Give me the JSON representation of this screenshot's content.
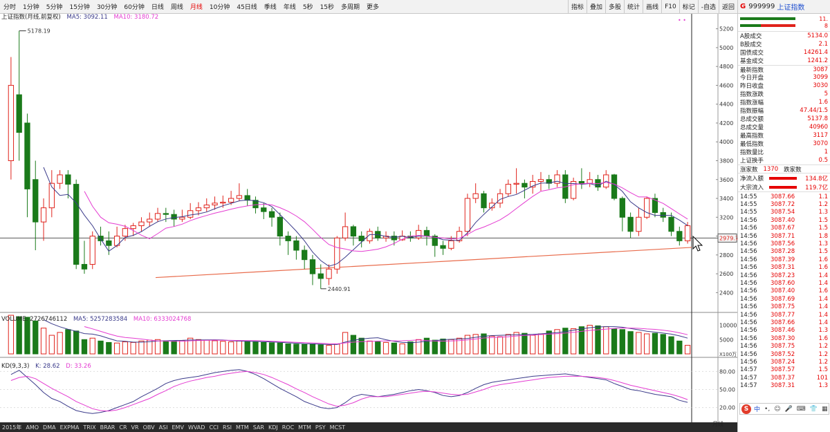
{
  "toolbar": {
    "periods": [
      "分时",
      "1分钟",
      "5分钟",
      "15分钟",
      "30分钟",
      "60分钟",
      "日线",
      "周线",
      "月线",
      "10分钟",
      "45日线",
      "季线",
      "年线",
      "5秒",
      "15秒",
      "多周期",
      "更多"
    ],
    "active_period": "月线",
    "right_tools": [
      "指标",
      "叠加",
      "多股",
      "统计",
      "画线",
      "F10",
      "标记",
      "-自选",
      "返回"
    ]
  },
  "legend": {
    "price_title": "上证指数(月线,前复权)",
    "ma5": "MA5: 3092.11",
    "ma10": "MA10: 3180.72",
    "volume": "VOLUME: 2726746112",
    "vol_ma5": "MA5: 5257283584",
    "vol_ma10": "MA10: 6333024768",
    "kd": "KD(9,3,3)",
    "kd_k": "K: 28.62",
    "kd_d": "D: 33.26"
  },
  "annotations": {
    "high": "5178.19",
    "low": "2440.91",
    "current_price": "2979.7",
    "vol_unit": "X100万"
  },
  "colors": {
    "up": "#e0221b",
    "down": "#1a7a1a",
    "ma5": "#3a3a8a",
    "ma10": "#e43bd1",
    "trend": "#e86a4a"
  },
  "chart_data": {
    "type": "candlestick",
    "price_axis": {
      "ylim": [
        2300,
        5300
      ],
      "ticks": [
        2400,
        2600,
        2800,
        3000,
        3200,
        3400,
        3600,
        3800,
        4000,
        4200,
        4400,
        4600,
        4800,
        5000,
        5200
      ]
    },
    "volume_axis": {
      "ylim": [
        0,
        14000
      ],
      "ticks": [
        5000,
        10000
      ]
    },
    "kd_axis": {
      "ylim": [
        0,
        100
      ],
      "ticks": [
        20.0,
        50.0,
        80.0
      ]
    },
    "candles": [
      {
        "o": 3800,
        "c": 4600,
        "h": 4900,
        "l": 3600
      },
      {
        "o": 4500,
        "c": 4100,
        "h": 5178.19,
        "l": 3800
      },
      {
        "o": 4200,
        "c": 3500,
        "h": 4300,
        "l": 3200
      },
      {
        "o": 3600,
        "c": 3150,
        "h": 3800,
        "l": 2850
      },
      {
        "o": 3150,
        "c": 3300,
        "h": 3400,
        "l": 2950
      },
      {
        "o": 3300,
        "c": 3560,
        "h": 3700,
        "l": 3200
      },
      {
        "o": 3560,
        "c": 3650,
        "h": 3700,
        "l": 3500
      },
      {
        "o": 3650,
        "c": 3550,
        "h": 3700,
        "l": 3400
      },
      {
        "o": 3550,
        "c": 2700,
        "h": 3600,
        "l": 2650
      },
      {
        "o": 2700,
        "c": 2650,
        "h": 2950,
        "l": 2600
      },
      {
        "o": 2700,
        "c": 3000,
        "h": 3050,
        "l": 2650
      },
      {
        "o": 3000,
        "c": 2950,
        "h": 3100,
        "l": 2900
      },
      {
        "o": 2950,
        "c": 2900,
        "h": 3050,
        "l": 2800
      },
      {
        "o": 2900,
        "c": 3000,
        "h": 3100,
        "l": 2880
      },
      {
        "o": 3000,
        "c": 3080,
        "h": 3120,
        "l": 2950
      },
      {
        "o": 3080,
        "c": 3110,
        "h": 3140,
        "l": 3000
      },
      {
        "o": 3110,
        "c": 3150,
        "h": 3200,
        "l": 3050
      },
      {
        "o": 3150,
        "c": 3180,
        "h": 3250,
        "l": 3100
      },
      {
        "o": 3180,
        "c": 3240,
        "h": 3300,
        "l": 3150
      },
      {
        "o": 3240,
        "c": 3230,
        "h": 3300,
        "l": 3150
      },
      {
        "o": 3230,
        "c": 3180,
        "h": 3280,
        "l": 3100
      },
      {
        "o": 3180,
        "c": 3200,
        "h": 3280,
        "l": 3150
      },
      {
        "o": 3200,
        "c": 3270,
        "h": 3350,
        "l": 3180
      },
      {
        "o": 3270,
        "c": 3300,
        "h": 3360,
        "l": 3220
      },
      {
        "o": 3300,
        "c": 3330,
        "h": 3400,
        "l": 3260
      },
      {
        "o": 3330,
        "c": 3350,
        "h": 3420,
        "l": 3280
      },
      {
        "o": 3350,
        "c": 3360,
        "h": 3430,
        "l": 3300
      },
      {
        "o": 3360,
        "c": 3400,
        "h": 3480,
        "l": 3330
      },
      {
        "o": 3400,
        "c": 3430,
        "h": 3560,
        "l": 3370
      },
      {
        "o": 3430,
        "c": 3380,
        "h": 3500,
        "l": 3320
      },
      {
        "o": 3380,
        "c": 3300,
        "h": 3420,
        "l": 3240
      },
      {
        "o": 3300,
        "c": 3260,
        "h": 3350,
        "l": 3180
      },
      {
        "o": 3260,
        "c": 3200,
        "h": 3300,
        "l": 3100
      },
      {
        "o": 3200,
        "c": 3000,
        "h": 3250,
        "l": 2900
      },
      {
        "o": 3000,
        "c": 2950,
        "h": 3050,
        "l": 2800
      },
      {
        "o": 2950,
        "c": 2850,
        "h": 3000,
        "l": 2750
      },
      {
        "o": 2850,
        "c": 2750,
        "h": 2900,
        "l": 2650
      },
      {
        "o": 2750,
        "c": 2600,
        "h": 2800,
        "l": 2480
      },
      {
        "o": 2600,
        "c": 2550,
        "h": 2700,
        "l": 2440.91
      },
      {
        "o": 2550,
        "c": 2650,
        "h": 2700,
        "l": 2480
      },
      {
        "o": 2650,
        "c": 2980,
        "h": 3000,
        "l": 2600
      },
      {
        "o": 2980,
        "c": 3100,
        "h": 3250,
        "l": 2950
      },
      {
        "o": 3100,
        "c": 3000,
        "h": 3120,
        "l": 2900
      },
      {
        "o": 3000,
        "c": 2950,
        "h": 3050,
        "l": 2880
      },
      {
        "o": 2950,
        "c": 3050,
        "h": 3080,
        "l": 2920
      },
      {
        "o": 3050,
        "c": 2980,
        "h": 3100,
        "l": 2950
      },
      {
        "o": 2980,
        "c": 3000,
        "h": 3050,
        "l": 2940
      },
      {
        "o": 3000,
        "c": 2960,
        "h": 3050,
        "l": 2900
      },
      {
        "o": 2960,
        "c": 3000,
        "h": 3060,
        "l": 2950
      },
      {
        "o": 3000,
        "c": 2980,
        "h": 3050,
        "l": 2940
      },
      {
        "o": 2980,
        "c": 3060,
        "h": 3120,
        "l": 2960
      },
      {
        "o": 3060,
        "c": 3000,
        "h": 3100,
        "l": 2900
      },
      {
        "o": 3000,
        "c": 2900,
        "h": 3020,
        "l": 2780
      },
      {
        "o": 2900,
        "c": 2870,
        "h": 2950,
        "l": 2800
      },
      {
        "o": 2870,
        "c": 2950,
        "h": 3000,
        "l": 2850
      },
      {
        "o": 2950,
        "c": 3050,
        "h": 3100,
        "l": 2930
      },
      {
        "o": 3050,
        "c": 3400,
        "h": 3450,
        "l": 3000
      },
      {
        "o": 3400,
        "c": 3450,
        "h": 3560,
        "l": 3350
      },
      {
        "o": 3450,
        "c": 3300,
        "h": 3480,
        "l": 3250
      },
      {
        "o": 3300,
        "c": 3350,
        "h": 3400,
        "l": 3270
      },
      {
        "o": 3350,
        "c": 3450,
        "h": 3500,
        "l": 3300
      },
      {
        "o": 3450,
        "c": 3550,
        "h": 3600,
        "l": 3420
      },
      {
        "o": 3550,
        "c": 3560,
        "h": 3720,
        "l": 3450
      },
      {
        "o": 3560,
        "c": 3520,
        "h": 3600,
        "l": 3400
      },
      {
        "o": 3520,
        "c": 3580,
        "h": 3650,
        "l": 3450
      },
      {
        "o": 3580,
        "c": 3600,
        "h": 3680,
        "l": 3480
      },
      {
        "o": 3600,
        "c": 3560,
        "h": 3650,
        "l": 3500
      },
      {
        "o": 3560,
        "c": 3650,
        "h": 3700,
        "l": 3520
      },
      {
        "o": 3650,
        "c": 3400,
        "h": 3700,
        "l": 3350
      },
      {
        "o": 3400,
        "c": 3580,
        "h": 3620,
        "l": 3380
      },
      {
        "o": 3580,
        "c": 3560,
        "h": 3720,
        "l": 3500
      },
      {
        "o": 3560,
        "c": 3600,
        "h": 3680,
        "l": 3520
      },
      {
        "o": 3600,
        "c": 3520,
        "h": 3650,
        "l": 3480
      },
      {
        "o": 3520,
        "c": 3650,
        "h": 3700,
        "l": 3500
      },
      {
        "o": 3650,
        "c": 3400,
        "h": 3660,
        "l": 3380
      },
      {
        "o": 3400,
        "c": 3200,
        "h": 3420,
        "l": 3050
      },
      {
        "o": 3200,
        "c": 3050,
        "h": 3250,
        "l": 2980
      },
      {
        "o": 3050,
        "c": 3200,
        "h": 3300,
        "l": 3000
      },
      {
        "o": 3200,
        "c": 3400,
        "h": 3420,
        "l": 3180
      },
      {
        "o": 3400,
        "c": 3250,
        "h": 3450,
        "l": 3200
      },
      {
        "o": 3250,
        "c": 3200,
        "h": 3300,
        "l": 3150
      },
      {
        "o": 3200,
        "c": 3050,
        "h": 3250,
        "l": 3000
      },
      {
        "o": 3050,
        "c": 2950,
        "h": 3100,
        "l": 2900
      },
      {
        "o": 2950,
        "c": 3110,
        "h": 3150,
        "l": 2920
      }
    ],
    "volumes": [
      13500,
      13000,
      12800,
      11500,
      9000,
      6500,
      7500,
      8500,
      8000,
      5000,
      5500,
      4500,
      4000,
      3800,
      4200,
      4000,
      4500,
      4800,
      5000,
      4600,
      4500,
      4700,
      5500,
      5000,
      4800,
      4600,
      4400,
      4200,
      4500,
      4400,
      4200,
      4000,
      3900,
      3800,
      3500,
      3400,
      3300,
      3500,
      3200,
      3000,
      3400,
      7500,
      6500,
      5500,
      4500,
      4200,
      4000,
      3800,
      3500,
      4200,
      5000,
      5500,
      4800,
      5200,
      5000,
      5500,
      6500,
      6800,
      7000,
      6200,
      6000,
      6800,
      7500,
      7200,
      6500,
      7000,
      8000,
      8500,
      9000,
      8800,
      9500,
      10000,
      9800,
      9500,
      8800,
      8500,
      7800,
      7500,
      7000,
      7200,
      6800,
      6000,
      4500,
      3000
    ],
    "kd": {
      "k": [
        75,
        82,
        70,
        58,
        45,
        35,
        30,
        22,
        15,
        12,
        10,
        12,
        15,
        20,
        25,
        30,
        38,
        45,
        52,
        60,
        65,
        68,
        70,
        72,
        75,
        78,
        80,
        82,
        83,
        80,
        75,
        68,
        60,
        52,
        45,
        38,
        30,
        25,
        20,
        18,
        20,
        28,
        38,
        42,
        40,
        38,
        40,
        42,
        45,
        48,
        50,
        48,
        45,
        40,
        38,
        40,
        45,
        52,
        58,
        62,
        64,
        66,
        68,
        70,
        72,
        73,
        74,
        75,
        76,
        74,
        72,
        70,
        68,
        66,
        60,
        55,
        50,
        48,
        45,
        42,
        40,
        38,
        32,
        28.62
      ],
      "d": [
        65,
        70,
        72,
        68,
        60,
        52,
        45,
        38,
        30,
        24,
        18,
        15,
        14,
        16,
        20,
        25,
        30,
        35,
        42,
        48,
        55,
        60,
        64,
        67,
        70,
        72,
        75,
        77,
        79,
        80,
        78,
        75,
        70,
        64,
        58,
        51,
        45,
        38,
        32,
        26,
        22,
        24,
        28,
        34,
        38,
        38,
        38,
        40,
        42,
        44,
        46,
        47,
        46,
        44,
        42,
        41,
        42,
        46,
        50,
        55,
        58,
        60,
        62,
        64,
        66,
        68,
        70,
        71,
        72,
        72,
        72,
        71,
        70,
        68,
        65,
        61,
        57,
        54,
        51,
        48,
        45,
        42,
        38,
        33.26
      ]
    }
  },
  "right_panel": {
    "g": "G",
    "code": "999999",
    "name": "上证指数",
    "bar_vals": [
      "11.",
      "8"
    ],
    "info": [
      {
        "label": "A股成交",
        "value": "5134.0"
      },
      {
        "label": "B股成交",
        "value": "2.1"
      },
      {
        "label": "国债成交",
        "value": "14261.4"
      },
      {
        "label": "基金成交",
        "value": "1241.2"
      },
      {
        "label": "最新指数",
        "value": "3087"
      },
      {
        "label": "今日开盘",
        "value": "3099"
      },
      {
        "label": "昨日收盘",
        "value": "3030"
      },
      {
        "label": "指数涨跌",
        "value": "5"
      },
      {
        "label": "指数涨幅",
        "value": "1.6"
      },
      {
        "label": "指数振幅",
        "value": "47.44/1.5"
      },
      {
        "label": "总成交额",
        "value": "5137.8"
      },
      {
        "label": "总成交量",
        "value": "40960"
      },
      {
        "label": "最高指数",
        "value": "3117"
      },
      {
        "label": "最低指数",
        "value": "3070"
      },
      {
        "label": "指数量比",
        "value": "1"
      },
      {
        "label": "上证换手",
        "value": "0.5"
      }
    ],
    "rise_fall": {
      "label": "涨家数",
      "value": "1370",
      "label2": "跌家数"
    },
    "flows": [
      {
        "label": "净流入额",
        "value": "134.8亿"
      },
      {
        "label": "大宗流入",
        "value": "119.7亿"
      }
    ],
    "ticks": [
      {
        "t": "14:55",
        "p": "3087.66",
        "v": "1.1"
      },
      {
        "t": "14:55",
        "p": "3087.72",
        "v": "1.2"
      },
      {
        "t": "14:55",
        "p": "3087.54",
        "v": "1.3"
      },
      {
        "t": "14:56",
        "p": "3087.40",
        "v": "1.5"
      },
      {
        "t": "14:56",
        "p": "3087.67",
        "v": "1.5"
      },
      {
        "t": "14:56",
        "p": "3087.71",
        "v": "1.8"
      },
      {
        "t": "14:56",
        "p": "3087.56",
        "v": "1.3"
      },
      {
        "t": "14:56",
        "p": "3087.28",
        "v": "1.5"
      },
      {
        "t": "14:56",
        "p": "3087.39",
        "v": "1.6"
      },
      {
        "t": "14:56",
        "p": "3087.31",
        "v": "1.6"
      },
      {
        "t": "14:56",
        "p": "3087.23",
        "v": "1.4"
      },
      {
        "t": "14:56",
        "p": "3087.60",
        "v": "1.4"
      },
      {
        "t": "14:56",
        "p": "3087.40",
        "v": "1.6"
      },
      {
        "t": "14:56",
        "p": "3087.69",
        "v": "1.4"
      },
      {
        "t": "14:56",
        "p": "3087.75",
        "v": "1.4"
      },
      {
        "t": "14:56",
        "p": "3087.77",
        "v": "1.4"
      },
      {
        "t": "14:56",
        "p": "3087.66",
        "v": "1.4"
      },
      {
        "t": "14:56",
        "p": "3087.46",
        "v": "1.3"
      },
      {
        "t": "14:56",
        "p": "3087.30",
        "v": "1.6"
      },
      {
        "t": "14:56",
        "p": "3087.75",
        "v": "1.2"
      },
      {
        "t": "14:56",
        "p": "3087.52",
        "v": "1.2"
      },
      {
        "t": "14:56",
        "p": "3087.24",
        "v": "1.2"
      },
      {
        "t": "14:57",
        "p": "3087.57",
        "v": "1.5"
      },
      {
        "t": "14:57",
        "p": "3087.37",
        "v": "101"
      },
      {
        "t": "14:57",
        "p": "3087.31",
        "v": "1.3"
      }
    ]
  },
  "bottom": {
    "tabs": [
      "2015年",
      "AMO",
      "DMA",
      "EXPMA",
      "TRIX",
      "BRAR",
      "CR",
      "VR",
      "OBV",
      "ASI",
      "EMV",
      "WVAD",
      "CCI",
      "RSI",
      "MTM",
      "SAR",
      "KDJ",
      "ROC",
      "MTM",
      "PSY",
      "MCST",
      "",
      ""
    ],
    "right_label": "月线"
  }
}
